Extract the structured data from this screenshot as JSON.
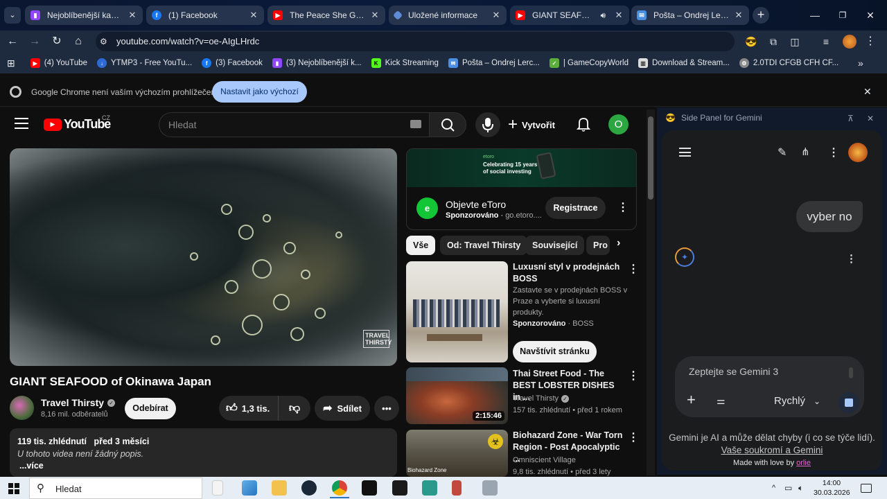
{
  "browser": {
    "tabs": [
      {
        "title": "Nejoblíbenější kanály - Twitch",
        "icon_color": "#9146ff",
        "active": false
      },
      {
        "title": "(1) Facebook",
        "icon_color": "#1877f2",
        "active": false
      },
      {
        "title": "The Peace She Guards | ",
        "icon_color": "#ff0000",
        "active": false
      },
      {
        "title": "Uložené informace",
        "icon_color": "#5f8bd6",
        "active": false
      },
      {
        "title": "GIANT SEAFOOD of ",
        "icon_color": "#ff0000",
        "active": true
      },
      {
        "title": "Pošta – Ondrej Lerch – Outlook",
        "icon_color": "#4a8fe0",
        "active": false
      }
    ],
    "url": "youtube.com/watch?v=oe-AIgLHrdc",
    "bookmarks": [
      {
        "label": "(4) YouTube",
        "icon_color": "#ff0000"
      },
      {
        "label": "YTMP3 - Free YouTu...",
        "icon_color": "#2d6ad8"
      },
      {
        "label": "(3) Facebook",
        "icon_color": "#1877f2"
      },
      {
        "label": "(3) Nejoblíbenější k...",
        "icon_color": "#9146ff"
      },
      {
        "label": "Kick Streaming",
        "icon_color": "#53fc18"
      },
      {
        "label": "Pošta – Ondrej Lerc...",
        "icon_color": "#4a8fe0"
      },
      {
        "label": "| GameCopyWorld",
        "icon_color": "#5bae3a"
      },
      {
        "label": "Download & Stream...",
        "icon_color": "#dddddd"
      },
      {
        "label": "2.0TDI CFGB CFH CF...",
        "icon_color": "#888888"
      }
    ],
    "default_bar": {
      "message": "Google Chrome není vaším výchozím prohlížečem",
      "button": "Nastavit jako výchozí"
    }
  },
  "youtube": {
    "logo_text": "YouTube",
    "region": "CZ",
    "search_placeholder": "Hledat",
    "create_label": "Vytvořit",
    "avatar_letter": "O",
    "video": {
      "title": "GIANT SEAFOOD of Okinawa Japan",
      "watermark_line1": "TRAVEL",
      "watermark_line2": "THIRSTY",
      "channel": "Travel Thirsty",
      "subscribers": "8,16 mil. odběratelů",
      "subscribe_label": "Odebírat",
      "likes": "1,3 tis.",
      "share_label": "Sdílet",
      "description": {
        "views": "119 tis. zhlédnutí",
        "date": "před 3 měsíci",
        "text": "U tohoto videa není žádný popis.",
        "more": "...více"
      }
    },
    "ad": {
      "banner_line1": "Celebrating 15 years",
      "banner_line2": "of social investing",
      "banner_brand": "etoro",
      "title": "Objevte eToro",
      "sponsored": "Sponzorováno",
      "domain": "go.etoro....",
      "cta": "Registrace"
    },
    "chips": [
      "Vše",
      "Od: Travel Thirsty",
      "Související",
      "Pro"
    ],
    "recommendations": [
      {
        "title": "Luxusní styl v prodejnách BOSS",
        "desc": "Zastavte se v prodejnách BOSS v Praze a vyberte si luxusní produkty.",
        "sponsored": "Sponzorováno",
        "brand": "BOSS",
        "cta": "Navštívit stránku"
      },
      {
        "title": "Thai Street Food - The BEST LOBSTER DISHES in ...",
        "channel": "Travel Thirsty",
        "meta": "157 tis. zhlédnutí • před 1 rokem",
        "duration": "2:15:46"
      },
      {
        "title": "Biohazard Zone - War Torn Region - Post Apocalyptic ...",
        "channel": "Omniscient Village",
        "meta": "9,8 tis. zhlédnutí • před 3 lety",
        "thumb_label": "Biohazard Zone"
      }
    ]
  },
  "gemini": {
    "header": "Side Panel for Gemini",
    "user_message": "vyber no",
    "input_placeholder": "Zeptejte se Gemini 3",
    "mode": "Rychlý",
    "disclaimer": "Gemini je AI a může dělat chyby (i co se týče lidí).",
    "privacy_link": "Vaše soukromí a Gemini",
    "made_with": "Made with love by",
    "author": "orlie"
  },
  "taskbar": {
    "search_placeholder": "Hledat",
    "time": "14:00",
    "date": "30.03.2026"
  },
  "colors": {
    "yt_red": "#ff0000",
    "gemini_blue": "#a8c7fa",
    "avatar_green": "#2ba640"
  }
}
